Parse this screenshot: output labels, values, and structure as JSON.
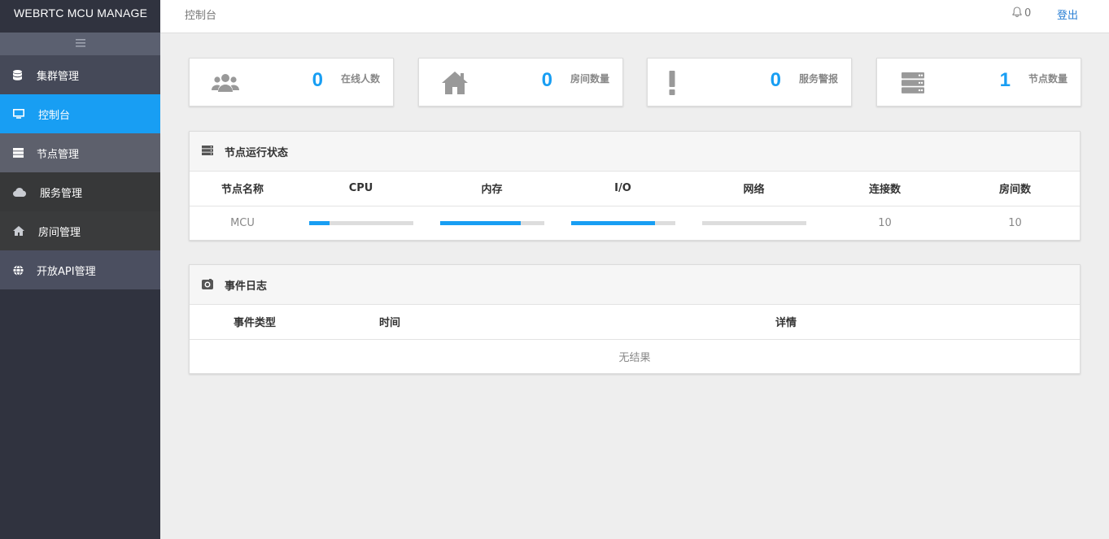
{
  "app": {
    "brand": "WEBRTC MCU MANAGE"
  },
  "header": {
    "breadcrumb": "控制台",
    "notifications": "0",
    "logout": "登出"
  },
  "sidebar": {
    "items": [
      {
        "label": "集群管理",
        "icon": "database-icon"
      },
      {
        "label": "控制台",
        "icon": "monitor-icon",
        "active": true
      },
      {
        "label": "节点管理",
        "icon": "server-icon"
      },
      {
        "label": "服务管理",
        "icon": "cloud-icon"
      },
      {
        "label": "房间管理",
        "icon": "home-icon"
      },
      {
        "label": "开放API管理",
        "icon": "globe-icon"
      }
    ]
  },
  "stats": [
    {
      "value": "0",
      "label": "在线人数",
      "icon": "users-icon"
    },
    {
      "value": "0",
      "label": "房间数量",
      "icon": "home-icon"
    },
    {
      "value": "0",
      "label": "服务警报",
      "icon": "exclamation-icon"
    },
    {
      "value": "1",
      "label": "节点数量",
      "icon": "server-icon"
    }
  ],
  "node_status": {
    "title": "节点运行状态",
    "columns": [
      "节点名称",
      "CPU",
      "内存",
      "I/O",
      "网络",
      "连接数",
      "房间数"
    ],
    "rows": [
      {
        "name": "MCU",
        "cpu": 0.2,
        "memory": 0.78,
        "io": 0.81,
        "network": 0.0,
        "connections": "10",
        "rooms": "10"
      }
    ]
  },
  "event_log": {
    "title": "事件日志",
    "columns": [
      "事件类型",
      "时间",
      "详情"
    ],
    "empty": "无结果"
  },
  "colors": {
    "accent": "#189ef3",
    "sidebar_bg": "#30333f"
  }
}
